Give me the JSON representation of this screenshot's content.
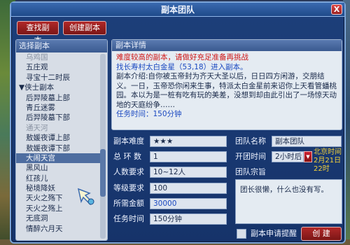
{
  "window": {
    "title": "副本团队",
    "close_glyph": "X"
  },
  "toolbar": {
    "find_label": "查找副本",
    "create_label": "创建副本"
  },
  "list": {
    "header": "选择副本",
    "items": [
      {
        "label": "乌鸡国",
        "kind": "dim"
      },
      {
        "label": "五庄观",
        "kind": "normal"
      },
      {
        "label": "寻宝十二时辰",
        "kind": "normal"
      },
      {
        "label": "▼侠士副本",
        "kind": "group"
      },
      {
        "label": "后羿陵墓上部",
        "kind": "normal"
      },
      {
        "label": "青丘迷雾",
        "kind": "normal"
      },
      {
        "label": "后羿陵墓下部",
        "kind": "normal"
      },
      {
        "label": "通天河",
        "kind": "dim"
      },
      {
        "label": "敖媛夜谭上部",
        "kind": "normal"
      },
      {
        "label": "敖媛夜谭下部",
        "kind": "normal"
      },
      {
        "label": "大闹天宫",
        "kind": "selected"
      },
      {
        "label": "黑风山",
        "kind": "normal"
      },
      {
        "label": "红孩儿",
        "kind": "normal"
      },
      {
        "label": "秘境降妖",
        "kind": "normal"
      },
      {
        "label": "天火之殇下",
        "kind": "normal"
      },
      {
        "label": "天火之殇上",
        "kind": "normal"
      },
      {
        "label": "无底洞",
        "kind": "normal"
      },
      {
        "label": "情醉六月天",
        "kind": "normal"
      }
    ]
  },
  "detail": {
    "header": "副本详情",
    "warning": "难度较高的副本，请做好充足准备再挑战",
    "npc_line": "找长寿村太白金星（53,18）进入副本。",
    "intro": "副本介绍:自你被玉帝封为齐天大圣以后，日日四方闲游，交朋结义。一日，玉帝恐你闲来生事，特派太白金星前来诏你上天看管蟠桃园。本以为是一桩有吃有玩的美差，没想到却由此引出了一场惊天动地的天庭纷争……",
    "time_label": "任务时间：",
    "time_value": "150分钟"
  },
  "form": {
    "difficulty_label": "副本难度",
    "difficulty_value": "★★★",
    "rounds_label": "总 环 数",
    "rounds_value": "1",
    "players_label": "人数要求",
    "players_value": "10~12人",
    "level_label": "等级要求",
    "level_value": "100",
    "gold_label": "所需金额",
    "gold_value": "30000",
    "task_time_label": "任务时间",
    "task_time_value": "150分钟",
    "team_name_label": "团队名称",
    "team_name_value": "副本团队",
    "open_time_label": "开团时间",
    "open_time_value": "2小时后",
    "beijing_time_label": "北京时间",
    "beijing_time_value": "2月21日22时",
    "motto_label": "团队宗旨",
    "motto_value": "团长很懒，什么也没有写。",
    "apply_reminder_label": "副本申请提醒",
    "create_button_label": "创 建"
  }
}
